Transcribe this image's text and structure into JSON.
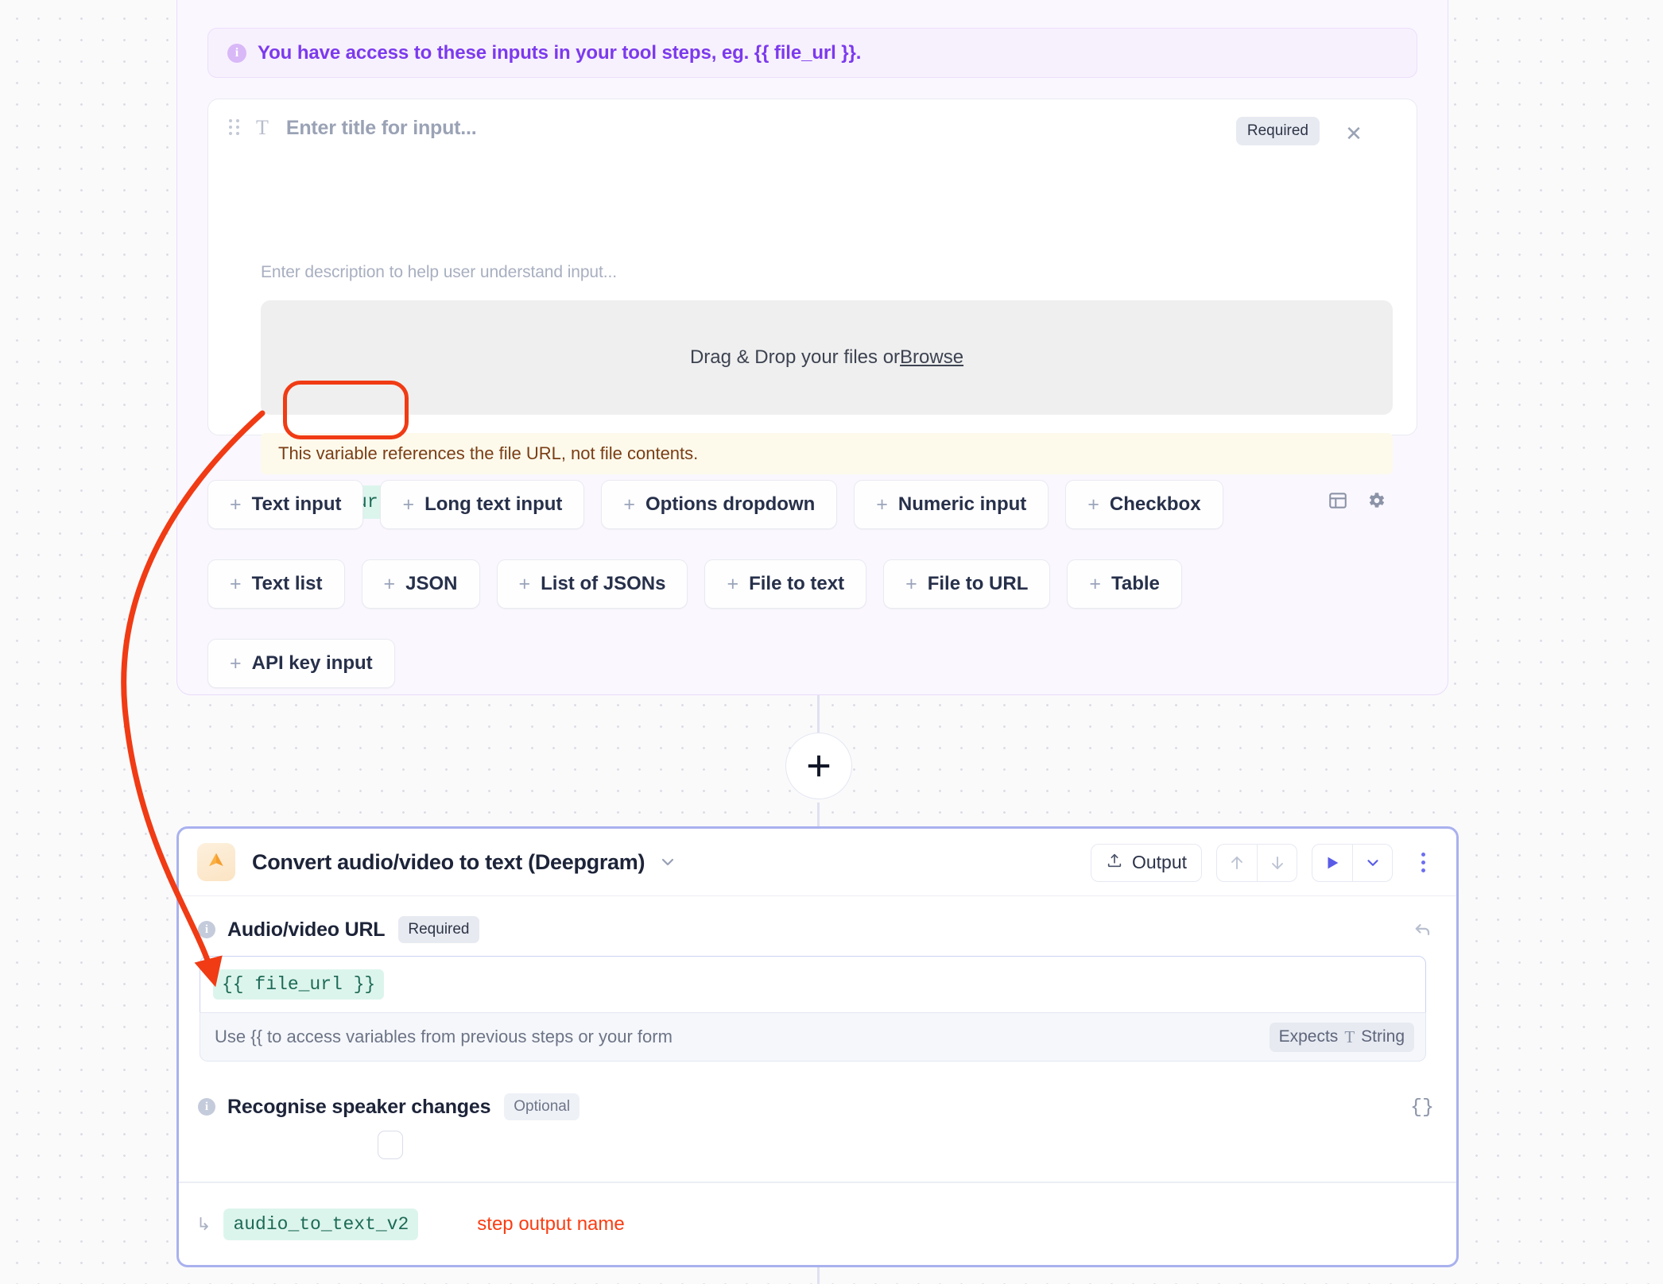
{
  "banner": {
    "icon": "info-icon",
    "text": "You have access to these inputs in your tool steps, eg. {{ file_url }}."
  },
  "input_card": {
    "title_placeholder": "Enter title for input...",
    "description_placeholder": "Enter description to help user understand input...",
    "type_glyph": "T",
    "required_badge": "Required",
    "close_label": "✕",
    "dropzone": {
      "text": "Drag & Drop your files or ",
      "browse_label": "Browse"
    },
    "warning": "This variable references the file URL, not file contents.",
    "variable_arrow": "↳",
    "variable_name": "file_url"
  },
  "input_types": [
    {
      "label": "Text input"
    },
    {
      "label": "Long text input"
    },
    {
      "label": "Options dropdown"
    },
    {
      "label": "Numeric input"
    },
    {
      "label": "Checkbox"
    },
    {
      "label": "Text list"
    },
    {
      "label": "JSON"
    },
    {
      "label": "List of JSONs"
    },
    {
      "label": "File to text"
    },
    {
      "label": "File to URL"
    },
    {
      "label": "Table"
    },
    {
      "label": "API key input"
    }
  ],
  "plus_glyph": "+",
  "step": {
    "title": "Convert audio/video to text (Deepgram)",
    "output_button": "Output",
    "fields": [
      {
        "label": "Audio/video URL",
        "badge": "Required",
        "value": "{{ file_url }}",
        "hint": "Use {{ to access variables from previous steps or your form",
        "expects_prefix": "Expects",
        "expects_glyph": "T",
        "expects_type": "String"
      },
      {
        "label": "Recognise speaker changes",
        "badge": "Optional",
        "braces": "{}"
      }
    ],
    "output_arrow": "↳",
    "output_name": "audio_to_text_v2",
    "output_annotation": "step output name"
  },
  "colors": {
    "accent_purple": "#7c3aed",
    "annotation_red": "#f03b14",
    "chip_green_bg": "#dcf5ec",
    "chip_green_fg": "#1d6a56",
    "step_border": "#a9b1ee",
    "warning_fg": "#7a3d14"
  }
}
